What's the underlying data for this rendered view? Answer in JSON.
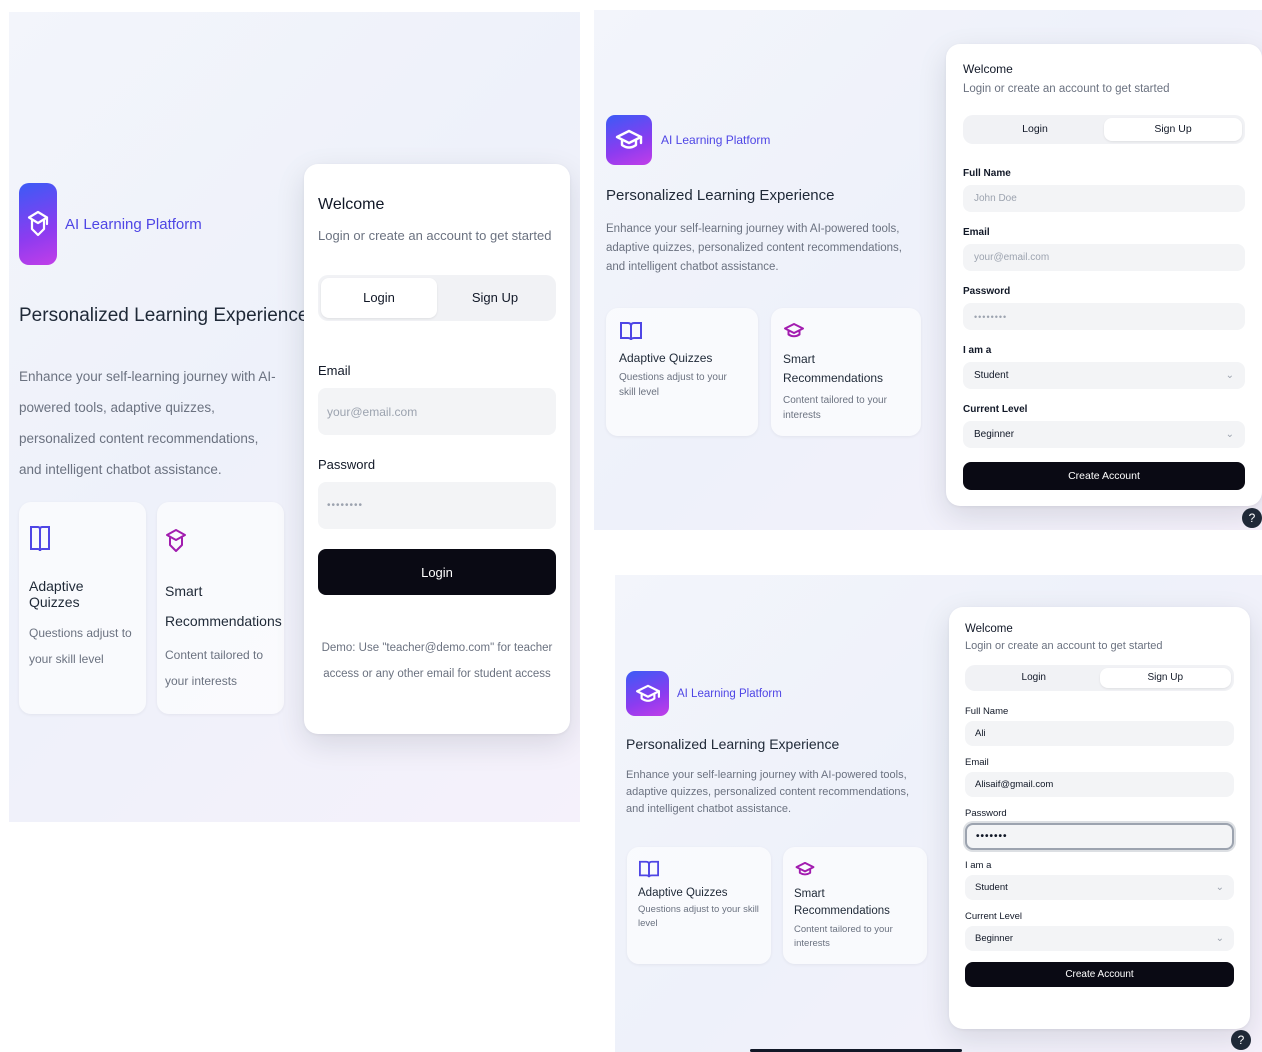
{
  "brand": {
    "name": "AI Learning Platform",
    "logo_icon": "graduation-cap-icon"
  },
  "hero": {
    "title": "Personalized Learning Experience",
    "description": "Enhance your self-learning journey with AI-powered tools, adaptive quizzes, personalized content recommendations, and intelligent chatbot assistance."
  },
  "features": [
    {
      "icon": "book-open-icon",
      "title": "Adaptive Quizzes",
      "description": "Questions adjust to your skill level"
    },
    {
      "icon": "graduation-cap-icon",
      "title": "Smart Recommendations",
      "description": "Content tailored to your interests"
    }
  ],
  "auth": {
    "title": "Welcome",
    "subtitle": "Login or create an account to get started",
    "tabs": {
      "login": "Login",
      "signup": "Sign Up"
    }
  },
  "login_screen": {
    "active_tab": "Login",
    "email": {
      "label": "Email",
      "placeholder": "your@email.com"
    },
    "password": {
      "label": "Password",
      "placeholder": "••••••••"
    },
    "submit_label": "Login",
    "demo_note": "Demo: Use \"teacher@demo.com\" for teacher access or any other email for student access"
  },
  "signup_empty": {
    "active_tab": "Sign Up",
    "full_name": {
      "label": "Full Name",
      "placeholder": "John Doe"
    },
    "email": {
      "label": "Email",
      "placeholder": "your@email.com"
    },
    "password": {
      "label": "Password",
      "placeholder": "••••••••"
    },
    "role": {
      "label": "I am a",
      "value": "Student"
    },
    "level": {
      "label": "Current Level",
      "value": "Beginner"
    },
    "submit_label": "Create Account"
  },
  "signup_filled": {
    "active_tab": "Sign Up",
    "full_name": {
      "label": "Full Name",
      "value": "Ali"
    },
    "email": {
      "label": "Email",
      "value": "Alisaif@gmail.com"
    },
    "password": {
      "label": "Password",
      "value": "•••••••"
    },
    "role": {
      "label": "I am a",
      "value": "Student"
    },
    "level": {
      "label": "Current Level",
      "value": "Beginner"
    },
    "submit_label": "Create Account"
  },
  "help_label": "?",
  "colors": {
    "accent": "#4f46e5",
    "button": "#0a0a14",
    "feature_icon_blue": "#4f46e5",
    "feature_icon_purple": "#a21caf"
  }
}
